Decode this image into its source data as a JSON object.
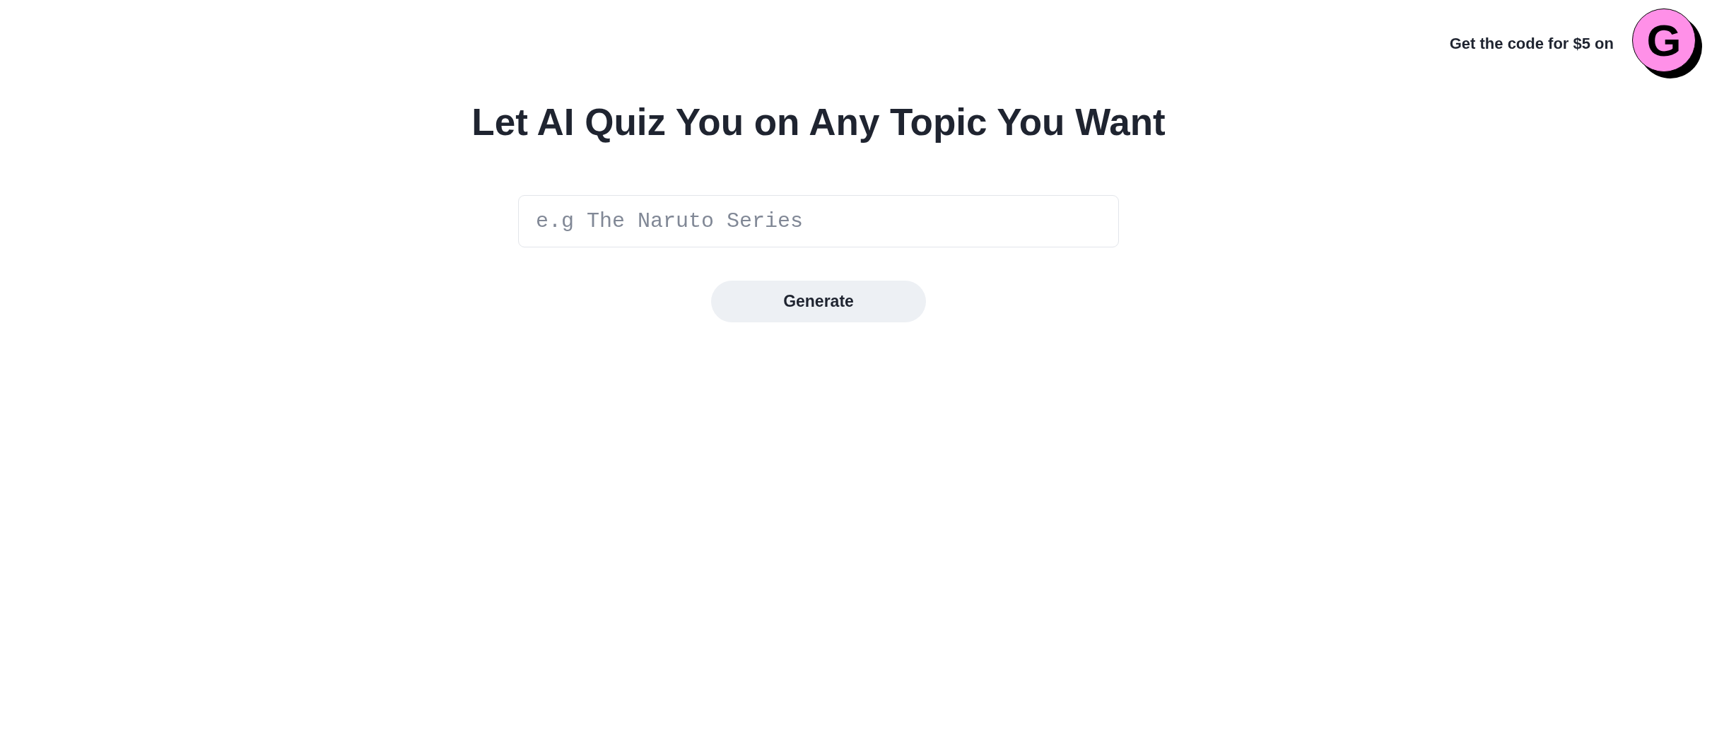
{
  "promo": {
    "text": "Get the code for $5 on",
    "logo_letter": "G"
  },
  "title": "Let AI Quiz You on Any Topic You Want",
  "topic_field": {
    "placeholder": "e.g The Naruto Series"
  },
  "generate_button": {
    "label": "Generate"
  }
}
